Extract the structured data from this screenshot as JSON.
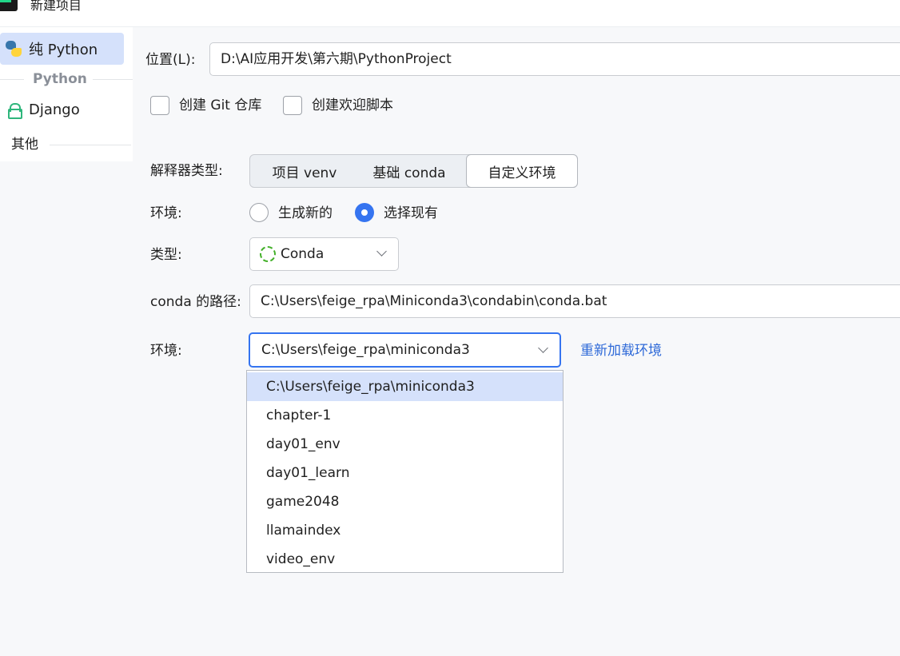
{
  "window": {
    "title": "新建项目"
  },
  "sidebar": {
    "items": [
      {
        "label": "纯 Python",
        "icon": "python-icon",
        "selected": true
      },
      {
        "label": "Django",
        "icon": "lock-icon",
        "selected": false
      }
    ],
    "group_label": "Python",
    "other_label": "其他"
  },
  "form": {
    "location_label": "位置(L):",
    "location_value": "D:\\AI应用开发\\第六期\\PythonProject",
    "create_git_label": "创建 Git 仓库",
    "create_git_checked": false,
    "create_welcome_label": "创建欢迎脚本",
    "create_welcome_checked": false,
    "interpreter_type_label": "解释器类型:",
    "interpreter_tabs": [
      "项目 venv",
      "基础 conda",
      "自定义环境"
    ],
    "interpreter_active": "自定义环境",
    "env_label": "环境:",
    "env_options": [
      "生成新的",
      "选择现有"
    ],
    "env_selected": "选择现有",
    "type_label": "类型:",
    "type_value": "Conda",
    "conda_path_label": "conda 的路径:",
    "conda_path_value": "C:\\Users\\feige_rpa\\Miniconda3\\condabin\\conda.bat",
    "env2_label": "环境:",
    "env2_value": "C:\\Users\\feige_rpa\\miniconda3",
    "reload_label": "重新加载环境"
  },
  "env_dropdown": {
    "items": [
      "C:\\Users\\feige_rpa\\miniconda3",
      "chapter-1",
      "day01_env",
      "day01_learn",
      "game2048",
      "llamaindex",
      "video_env"
    ],
    "selected": "C:\\Users\\feige_rpa\\miniconda3"
  },
  "colors": {
    "accent": "#3574f0",
    "selection": "#d5e1fb",
    "link": "#2f6ad8",
    "conda_green": "#43b02a"
  }
}
